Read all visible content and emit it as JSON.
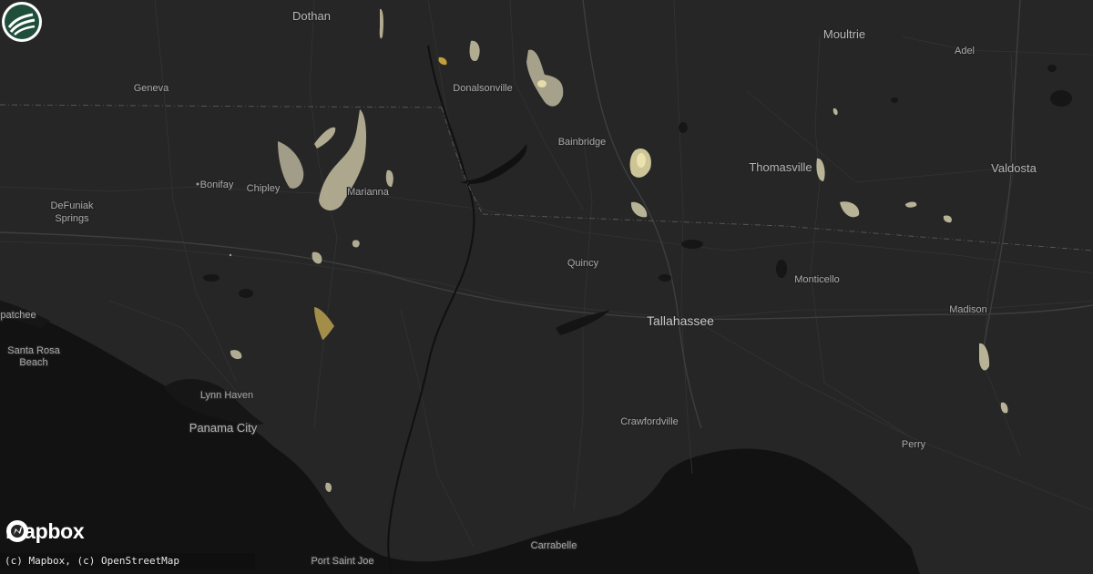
{
  "map": {
    "provider_logo_text": "mapbox",
    "attribution": "(c) Mapbox, (c) OpenStreetMap",
    "colors": {
      "background": "#262626",
      "water": "#111111",
      "roads": "#343434",
      "state_border": "#5a5a5a",
      "overlay_pale": "#b8b39a",
      "overlay_light": "#d8cf9c",
      "overlay_gold": "#b99b3a"
    },
    "icons": [
      "mapbox-logo-icon",
      "site-badge-icon"
    ],
    "places": [
      {
        "name": "Dothan",
        "size": "med"
      },
      {
        "name": "Geneva",
        "size": "small"
      },
      {
        "name": "Donalsonville",
        "size": "small"
      },
      {
        "name": "Bonifay",
        "size": "small"
      },
      {
        "name": "Chipley",
        "size": "small"
      },
      {
        "name": "Marianna",
        "size": "small"
      },
      {
        "name": "DeFuniak",
        "size": "small"
      },
      {
        "name": "Springs",
        "size": "small"
      },
      {
        "name": "Bainbridge",
        "size": "small"
      },
      {
        "name": "Moultrie",
        "size": "med"
      },
      {
        "name": "Adel",
        "size": "small"
      },
      {
        "name": "Thomasville",
        "size": "med"
      },
      {
        "name": "Valdosta",
        "size": "med"
      },
      {
        "name": "Quincy",
        "size": "small"
      },
      {
        "name": "Monticello",
        "size": "small"
      },
      {
        "name": "Tallahassee",
        "size": "big"
      },
      {
        "name": "Madison",
        "size": "small"
      },
      {
        "name": "patchee",
        "size": "small"
      },
      {
        "name": "Santa Rosa",
        "size": "small"
      },
      {
        "name": "Beach",
        "size": "small"
      },
      {
        "name": "Lynn Haven",
        "size": "small"
      },
      {
        "name": "Panama City",
        "size": "med"
      },
      {
        "name": "Crawfordville",
        "size": "small"
      },
      {
        "name": "Perry",
        "size": "small"
      },
      {
        "name": "Carrabelle",
        "size": "small"
      },
      {
        "name": "Port Saint Joe",
        "size": "small"
      }
    ]
  }
}
